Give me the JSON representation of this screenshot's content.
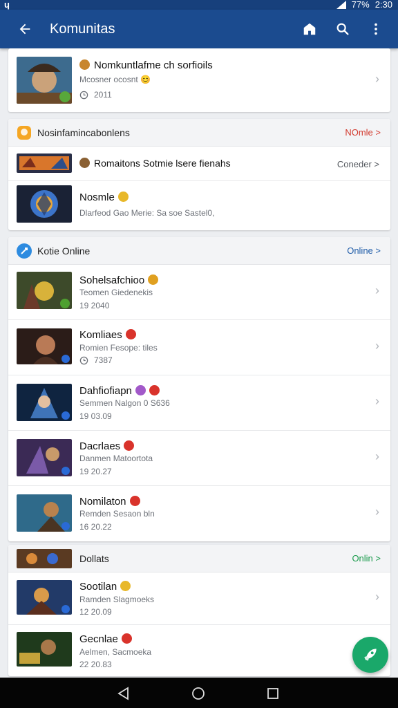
{
  "status_bar": {
    "left": "ɥ",
    "battery": "77%",
    "time": "2:30"
  },
  "app_bar": {
    "title": "Komunitas"
  },
  "card1": {
    "title": "Nomkuntlafme ch sorfioils",
    "subtitle": "Mcosner ocosnt 😊",
    "meta": "2011"
  },
  "card2": {
    "header_title": "Nosinfamincabonlens",
    "header_link": "NOmle >",
    "header_link_color": "#d23b2f",
    "rows": [
      {
        "title": "Romaitons Sotmie lsere fienahs",
        "right_label": "Coneder >"
      },
      {
        "title": "Nosmle",
        "subtitle": "Dlarfeod Gao Merie: Sa soe Sastel0,"
      }
    ]
  },
  "card3": {
    "header_title": "Kotie Online",
    "header_link": "Online >",
    "header_link_color": "#1f5ca8",
    "rows": [
      {
        "title": "Sohelsafchioo",
        "subtitle": "Teomen Giedenekis",
        "meta": "19 2040"
      },
      {
        "title": "Komliaes",
        "subtitle": "Romien Fesope: tiles",
        "meta": "7387"
      },
      {
        "title": "Dahfiofiapn",
        "subtitle": "Semmen Nalgon 0 S636",
        "meta": "19 03.09"
      },
      {
        "title": "Dacrlaes",
        "subtitle": "Danmen Matoortota",
        "meta": "19 20.27"
      },
      {
        "title": "Nomilaton",
        "subtitle": "Remden Sesaon bln",
        "meta": "16 20.22"
      }
    ]
  },
  "card4": {
    "header_title": "Dollats",
    "header_link": "Onlin >",
    "header_link_color": "#1a9b4c",
    "rows": [
      {
        "title": "Sootilan",
        "subtitle": "Ramden Slagmoeks",
        "meta": "12 20.09"
      },
      {
        "title": "Gecnlae",
        "subtitle": "Aelmen, Sacmoeka",
        "meta": "22 20.83"
      }
    ]
  },
  "icons": {
    "back": "arrow-left-icon",
    "home": "home-icon",
    "search": "search-icon",
    "more": "more-vert-icon",
    "fab": "rocket-icon"
  },
  "colors": {
    "app_bar": "#1b4b8f",
    "fab": "#1aa86a",
    "nav_bar": "#050505"
  }
}
